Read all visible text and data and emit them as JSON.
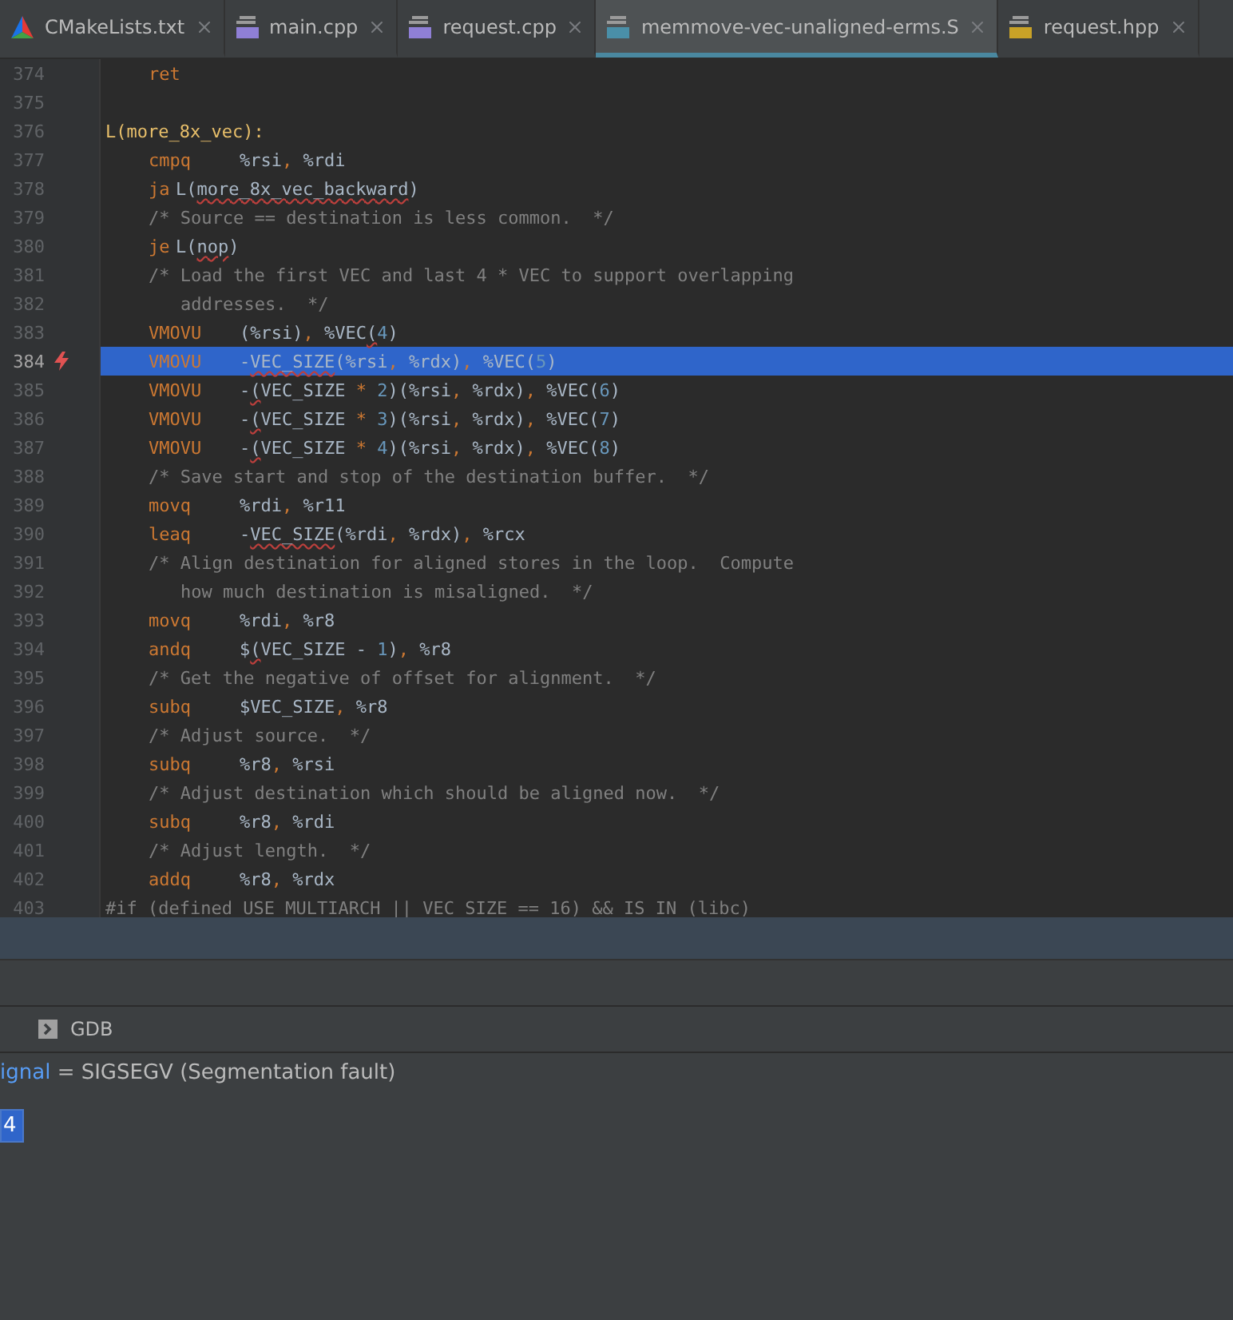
{
  "tabs": [
    {
      "label": "CMakeLists.txt",
      "kind": "cmake",
      "selected": false
    },
    {
      "label": "main.cpp",
      "kind": "cpp",
      "selected": false
    },
    {
      "label": "request.cpp",
      "kind": "cpp",
      "selected": false
    },
    {
      "label": "memmove-vec-unaligned-erms.S",
      "kind": "asm",
      "selected": true
    },
    {
      "label": "request.hpp",
      "kind": "header",
      "selected": false
    }
  ],
  "editor": {
    "lines": [
      {
        "number": "374",
        "kind": "instruction",
        "selected": false,
        "tokens": [
          {
            "kind": "mnemonic",
            "text": "ret"
          }
        ]
      },
      {
        "number": "375",
        "kind": "blank",
        "selected": false
      },
      {
        "number": "376",
        "kind": "label",
        "selected": false,
        "tokens": [
          {
            "kind": "label",
            "text": "L(more_8x_vec):"
          }
        ]
      },
      {
        "number": "377",
        "kind": "instruction",
        "selected": false,
        "tokens": [
          {
            "kind": "mnemonic",
            "text": "cmpq"
          },
          {
            "kind": "reg",
            "text": "%rsi"
          },
          {
            "kind": "punct",
            "text": ", "
          },
          {
            "kind": "reg",
            "text": "%rdi"
          }
        ]
      },
      {
        "number": "378",
        "kind": "jump",
        "selected": false,
        "tokens": [
          {
            "kind": "mnemonic",
            "text": "ja"
          },
          {
            "kind": "operand",
            "text": "L("
          },
          {
            "kind": "flagged",
            "text": "more_8x_vec_backward"
          },
          {
            "kind": "operand",
            "text": ")"
          }
        ]
      },
      {
        "number": "379",
        "kind": "instruction",
        "selected": false,
        "tokens": [
          {
            "kind": "comment",
            "text": "/* Source == destination is less common.  */"
          }
        ]
      },
      {
        "number": "380",
        "kind": "jump",
        "selected": false,
        "tokens": [
          {
            "kind": "mnemonic",
            "text": "je"
          },
          {
            "kind": "operand",
            "text": "L("
          },
          {
            "kind": "flagged",
            "text": "nop"
          },
          {
            "kind": "operand",
            "text": ")"
          }
        ]
      },
      {
        "number": "381",
        "kind": "instruction",
        "selected": false,
        "tokens": [
          {
            "kind": "comment",
            "text": "/* Load the first VEC and last 4 * VEC to support overlapping"
          }
        ]
      },
      {
        "number": "382",
        "kind": "continuation",
        "selected": false,
        "tokens": [
          {
            "kind": "comment",
            "text": "addresses.  */"
          }
        ]
      },
      {
        "number": "383",
        "kind": "instruction",
        "selected": false,
        "tokens": [
          {
            "kind": "mnemonic",
            "text": "VMOVU"
          },
          {
            "kind": "operand",
            "text": "("
          },
          {
            "kind": "reg",
            "text": "%rsi"
          },
          {
            "kind": "operand",
            "text": ")"
          },
          {
            "kind": "punct",
            "text": ", "
          },
          {
            "kind": "reg",
            "text": "%VEC"
          },
          {
            "kind": "flagged",
            "text": "("
          },
          {
            "kind": "number",
            "text": "4"
          },
          {
            "kind": "operand",
            "text": ")"
          }
        ]
      },
      {
        "number": "384",
        "kind": "instruction",
        "selected": true,
        "tokens": [
          {
            "kind": "mnemonic",
            "text": "VMOVU"
          },
          {
            "kind": "operand",
            "text": "-"
          },
          {
            "kind": "flagged",
            "text": "VEC_SIZE"
          },
          {
            "kind": "operand",
            "text": "("
          },
          {
            "kind": "reg",
            "text": "%rsi"
          },
          {
            "kind": "punct",
            "text": ", "
          },
          {
            "kind": "reg",
            "text": "%rdx"
          },
          {
            "kind": "operand",
            "text": ")"
          },
          {
            "kind": "punct",
            "text": ", "
          },
          {
            "kind": "reg",
            "text": "%VEC"
          },
          {
            "kind": "operand",
            "text": "("
          },
          {
            "kind": "number",
            "text": "5"
          },
          {
            "kind": "operand",
            "text": ")"
          }
        ]
      },
      {
        "number": "385",
        "kind": "instruction",
        "selected": false,
        "tokens": [
          {
            "kind": "mnemonic",
            "text": "VMOVU"
          },
          {
            "kind": "operand",
            "text": "-"
          },
          {
            "kind": "flagged",
            "text": "("
          },
          {
            "kind": "operand",
            "text": "VEC_SIZE "
          },
          {
            "kind": "punct",
            "text": "* "
          },
          {
            "kind": "number",
            "text": "2"
          },
          {
            "kind": "operand",
            "text": ")("
          },
          {
            "kind": "reg",
            "text": "%rsi"
          },
          {
            "kind": "punct",
            "text": ", "
          },
          {
            "kind": "reg",
            "text": "%rdx"
          },
          {
            "kind": "operand",
            "text": ")"
          },
          {
            "kind": "punct",
            "text": ", "
          },
          {
            "kind": "reg",
            "text": "%VEC"
          },
          {
            "kind": "operand",
            "text": "("
          },
          {
            "kind": "number",
            "text": "6"
          },
          {
            "kind": "operand",
            "text": ")"
          }
        ]
      },
      {
        "number": "386",
        "kind": "instruction",
        "selected": false,
        "tokens": [
          {
            "kind": "mnemonic",
            "text": "VMOVU"
          },
          {
            "kind": "operand",
            "text": "-"
          },
          {
            "kind": "flagged",
            "text": "("
          },
          {
            "kind": "operand",
            "text": "VEC_SIZE "
          },
          {
            "kind": "punct",
            "text": "* "
          },
          {
            "kind": "number",
            "text": "3"
          },
          {
            "kind": "operand",
            "text": ")("
          },
          {
            "kind": "reg",
            "text": "%rsi"
          },
          {
            "kind": "punct",
            "text": ", "
          },
          {
            "kind": "reg",
            "text": "%rdx"
          },
          {
            "kind": "operand",
            "text": ")"
          },
          {
            "kind": "punct",
            "text": ", "
          },
          {
            "kind": "reg",
            "text": "%VEC"
          },
          {
            "kind": "operand",
            "text": "("
          },
          {
            "kind": "number",
            "text": "7"
          },
          {
            "kind": "operand",
            "text": ")"
          }
        ]
      },
      {
        "number": "387",
        "kind": "instruction",
        "selected": false,
        "tokens": [
          {
            "kind": "mnemonic",
            "text": "VMOVU"
          },
          {
            "kind": "operand",
            "text": "-"
          },
          {
            "kind": "flagged",
            "text": "("
          },
          {
            "kind": "operand",
            "text": "VEC_SIZE "
          },
          {
            "kind": "punct",
            "text": "* "
          },
          {
            "kind": "number",
            "text": "4"
          },
          {
            "kind": "operand",
            "text": ")("
          },
          {
            "kind": "reg",
            "text": "%rsi"
          },
          {
            "kind": "punct",
            "text": ", "
          },
          {
            "kind": "reg",
            "text": "%rdx"
          },
          {
            "kind": "operand",
            "text": ")"
          },
          {
            "kind": "punct",
            "text": ", "
          },
          {
            "kind": "reg",
            "text": "%VEC"
          },
          {
            "kind": "operand",
            "text": "("
          },
          {
            "kind": "number",
            "text": "8"
          },
          {
            "kind": "operand",
            "text": ")"
          }
        ]
      },
      {
        "number": "388",
        "kind": "instruction",
        "selected": false,
        "tokens": [
          {
            "kind": "comment",
            "text": "/* Save start and stop of the destination buffer.  */"
          }
        ]
      },
      {
        "number": "389",
        "kind": "instruction",
        "selected": false,
        "tokens": [
          {
            "kind": "mnemonic",
            "text": "movq"
          },
          {
            "kind": "reg",
            "text": "%rdi"
          },
          {
            "kind": "punct",
            "text": ", "
          },
          {
            "kind": "reg",
            "text": "%r11"
          }
        ]
      },
      {
        "number": "390",
        "kind": "instruction",
        "selected": false,
        "tokens": [
          {
            "kind": "mnemonic",
            "text": "leaq"
          },
          {
            "kind": "operand",
            "text": "-"
          },
          {
            "kind": "flagged",
            "text": "VEC_SIZE"
          },
          {
            "kind": "operand",
            "text": "("
          },
          {
            "kind": "reg",
            "text": "%rdi"
          },
          {
            "kind": "punct",
            "text": ", "
          },
          {
            "kind": "reg",
            "text": "%rdx"
          },
          {
            "kind": "operand",
            "text": ")"
          },
          {
            "kind": "punct",
            "text": ", "
          },
          {
            "kind": "reg",
            "text": "%rcx"
          }
        ]
      },
      {
        "number": "391",
        "kind": "instruction",
        "selected": false,
        "tokens": [
          {
            "kind": "comment",
            "text": "/* Align destination for aligned stores in the loop.  Compute"
          }
        ]
      },
      {
        "number": "392",
        "kind": "continuation",
        "selected": false,
        "tokens": [
          {
            "kind": "comment",
            "text": "how much destination is misaligned.  */"
          }
        ]
      },
      {
        "number": "393",
        "kind": "instruction",
        "selected": false,
        "tokens": [
          {
            "kind": "mnemonic",
            "text": "movq"
          },
          {
            "kind": "reg",
            "text": "%rdi"
          },
          {
            "kind": "punct",
            "text": ", "
          },
          {
            "kind": "reg",
            "text": "%r8"
          }
        ]
      },
      {
        "number": "394",
        "kind": "instruction",
        "selected": false,
        "tokens": [
          {
            "kind": "mnemonic",
            "text": "andq"
          },
          {
            "kind": "operand",
            "text": "$"
          },
          {
            "kind": "flagged",
            "text": "("
          },
          {
            "kind": "operand",
            "text": "VEC_SIZE - "
          },
          {
            "kind": "number",
            "text": "1"
          },
          {
            "kind": "operand",
            "text": ")"
          },
          {
            "kind": "punct",
            "text": ", "
          },
          {
            "kind": "reg",
            "text": "%r8"
          }
        ]
      },
      {
        "number": "395",
        "kind": "instruction",
        "selected": false,
        "tokens": [
          {
            "kind": "comment",
            "text": "/* Get the negative of offset for alignment.  */"
          }
        ]
      },
      {
        "number": "396",
        "kind": "instruction",
        "selected": false,
        "tokens": [
          {
            "kind": "mnemonic",
            "text": "subq"
          },
          {
            "kind": "operand",
            "text": "$VEC_SIZE"
          },
          {
            "kind": "punct",
            "text": ", "
          },
          {
            "kind": "reg",
            "text": "%r8"
          }
        ]
      },
      {
        "number": "397",
        "kind": "instruction",
        "selected": false,
        "tokens": [
          {
            "kind": "comment",
            "text": "/* Adjust source.  */"
          }
        ]
      },
      {
        "number": "398",
        "kind": "instruction",
        "selected": false,
        "tokens": [
          {
            "kind": "mnemonic",
            "text": "subq"
          },
          {
            "kind": "reg",
            "text": "%r8"
          },
          {
            "kind": "punct",
            "text": ", "
          },
          {
            "kind": "reg",
            "text": "%rsi"
          }
        ]
      },
      {
        "number": "399",
        "kind": "instruction",
        "selected": false,
        "tokens": [
          {
            "kind": "comment",
            "text": "/* Adjust destination which should be aligned now.  */"
          }
        ]
      },
      {
        "number": "400",
        "kind": "instruction",
        "selected": false,
        "tokens": [
          {
            "kind": "mnemonic",
            "text": "subq"
          },
          {
            "kind": "reg",
            "text": "%r8"
          },
          {
            "kind": "punct",
            "text": ", "
          },
          {
            "kind": "reg",
            "text": "%rdi"
          }
        ]
      },
      {
        "number": "401",
        "kind": "instruction",
        "selected": false,
        "tokens": [
          {
            "kind": "comment",
            "text": "/* Adjust length.  */"
          }
        ]
      },
      {
        "number": "402",
        "kind": "instruction",
        "selected": false,
        "tokens": [
          {
            "kind": "mnemonic",
            "text": "addq"
          },
          {
            "kind": "reg",
            "text": "%r8"
          },
          {
            "kind": "punct",
            "text": ", "
          },
          {
            "kind": "reg",
            "text": "%rdx"
          }
        ]
      },
      {
        "number": "403",
        "kind": "label",
        "selected": false,
        "tokens": [
          {
            "kind": "comment",
            "text": "#if (defined USE_MULTIARCH || VEC_SIZE == 16) && IS_IN (libc)"
          }
        ]
      }
    ]
  },
  "debug": {
    "tabs": [
      {
        "label": "GDB",
        "selected": false
      }
    ],
    "frame": {
      "name": "ignal",
      "value": "= SIGSEGV (Segmentation fault)"
    },
    "badge": "4"
  }
}
